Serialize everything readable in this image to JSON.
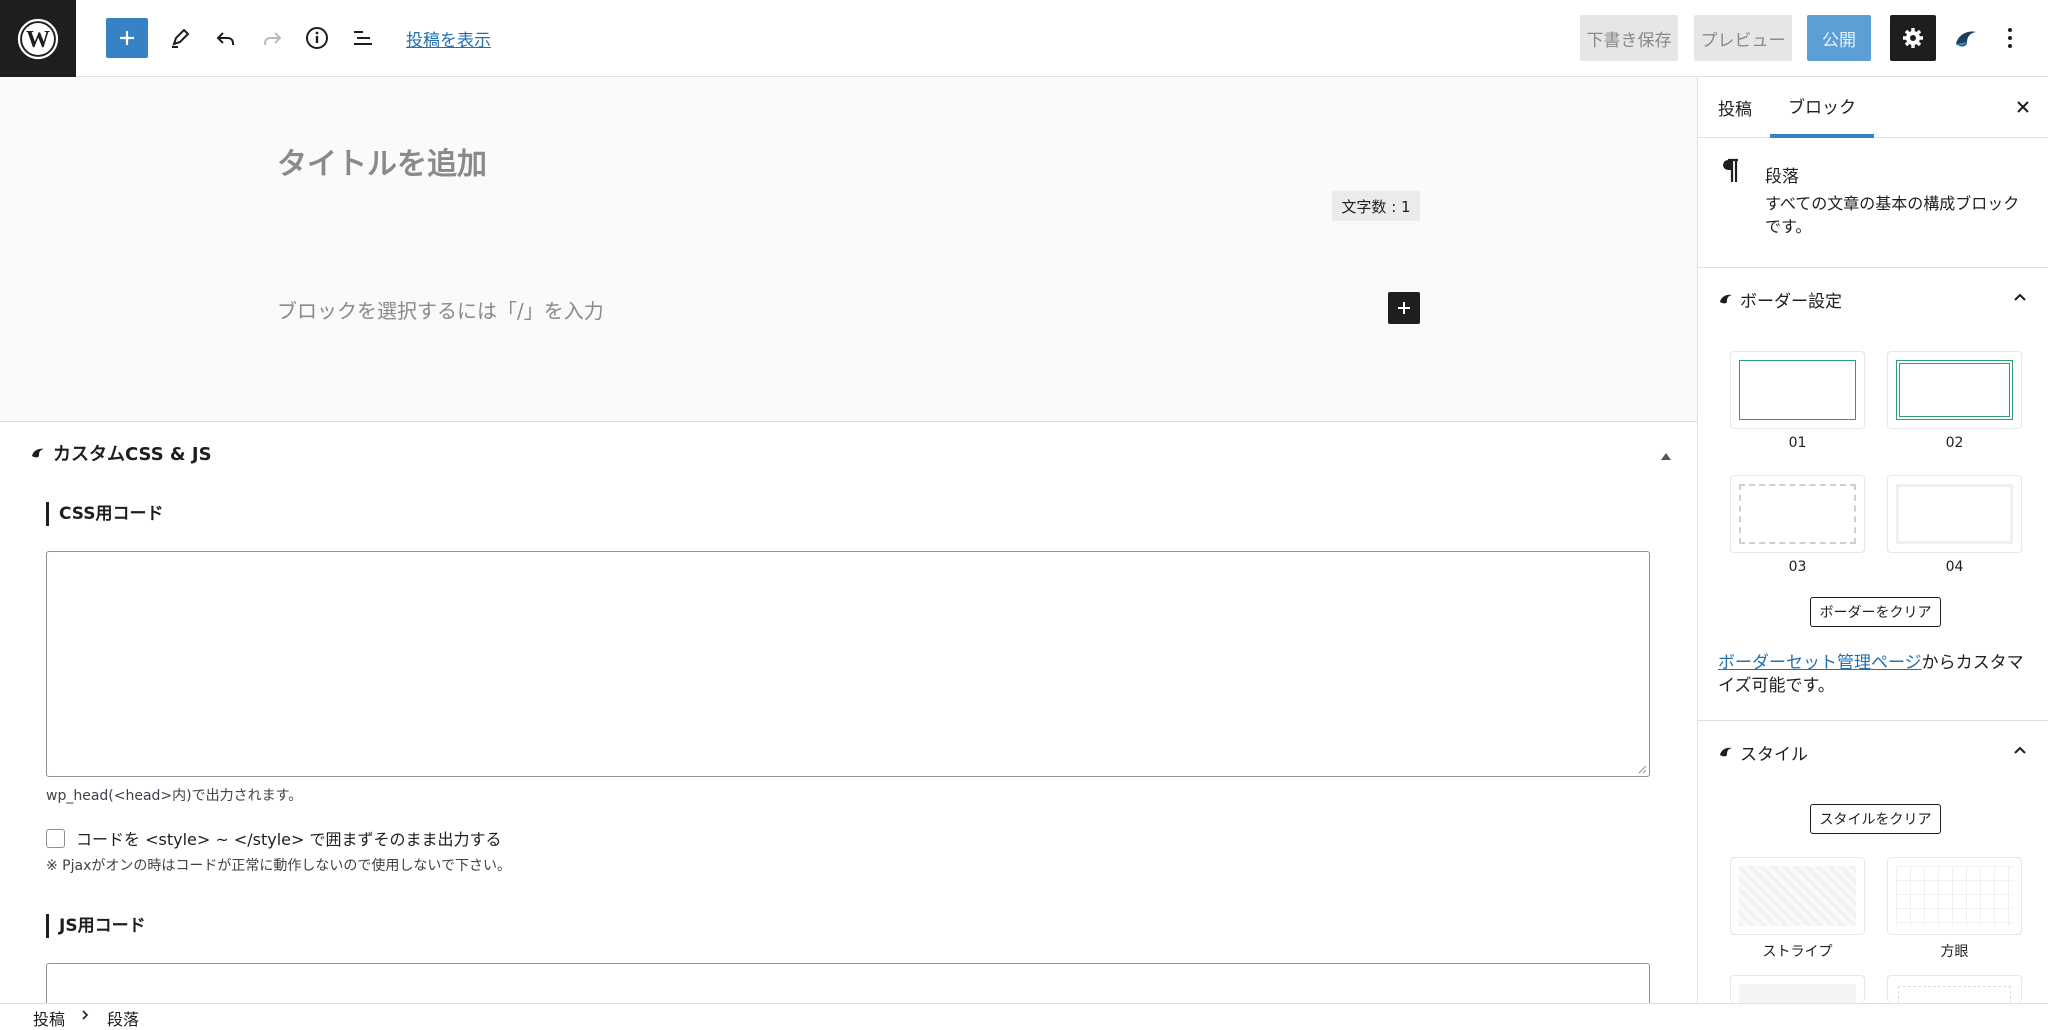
{
  "toolbar": {
    "view_post_link": "投稿を表示",
    "save_draft": "下書き保存",
    "preview": "プレビュー",
    "publish": "公開"
  },
  "editor": {
    "title_placeholder": "タイトルを追加",
    "word_count": "文字数 : 1",
    "block_placeholder": "ブロックを選択するには「/」を入力"
  },
  "custom_css_js": {
    "title": "カスタムCSS & JS",
    "css_heading": "CSS用コード",
    "css_note": "wp_head(<head>内)で出力されます。",
    "checkbox_label": "コードを <style> ~ </style> で囲まずそのまま出力する",
    "pjax_note": "※ Pjaxがオンの時はコードが正常に動作しないので使用しないで下さい。",
    "js_heading": "JS用コード"
  },
  "sidebar": {
    "tabs": [
      "投稿",
      "ブロック"
    ],
    "active_tab": "ブロック",
    "block_card": {
      "name": "段落",
      "description": "すべての文章の基本の構成ブロックです。"
    },
    "border_panel": {
      "title": "ボーダー設定",
      "options": [
        "01",
        "02",
        "03",
        "04"
      ],
      "clear_button": "ボーダーをクリア",
      "link_text": "ボーダーセット管理ページ",
      "link_suffix": "からカスタマイズ可能です。"
    },
    "style_panel": {
      "title": "スタイル",
      "clear_button": "スタイルをクリア",
      "options": [
        "ストライプ",
        "方眼"
      ]
    }
  },
  "breadcrumb": [
    "投稿",
    "段落"
  ],
  "colors": {
    "accent": "#3582c4",
    "dark": "#1e1e1e",
    "border_green": "#2e9e6a"
  }
}
